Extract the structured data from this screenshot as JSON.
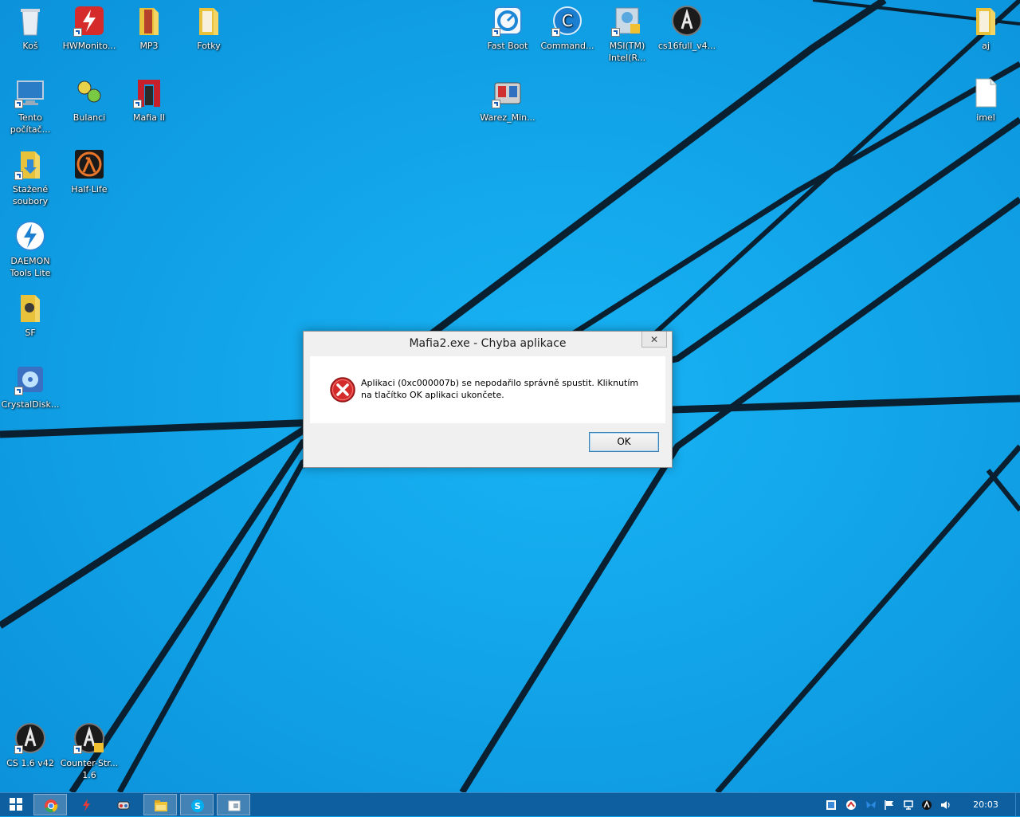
{
  "desktop": {
    "icons": [
      {
        "label": "Koš",
        "icon": "recycle-bin-icon"
      },
      {
        "label": "HWMonito...",
        "icon": "hwmonitor-icon"
      },
      {
        "label": "MP3",
        "icon": "folder-icon"
      },
      {
        "label": "Fotky",
        "icon": "folder-icon"
      },
      {
        "label": "Fast Boot",
        "icon": "fast-boot-icon"
      },
      {
        "label": "Command...",
        "icon": "command-center-icon"
      },
      {
        "label": "MSI(TM) Intel(R...",
        "icon": "msi-icon"
      },
      {
        "label": "cs16full_v4...",
        "icon": "counter-strike-icon"
      },
      {
        "label": "aj",
        "icon": "folder-icon"
      },
      {
        "label": "Tento počítač...",
        "icon": "computer-icon"
      },
      {
        "label": "Bulanci",
        "icon": "bulanci-icon"
      },
      {
        "label": "Mafia II",
        "icon": "mafia-icon"
      },
      {
        "label": "Warez_Min...",
        "icon": "warez-icon"
      },
      {
        "label": "imel",
        "icon": "file-icon"
      },
      {
        "label": "Stažené soubory",
        "icon": "downloads-folder-icon"
      },
      {
        "label": "Half-Life",
        "icon": "half-life-icon"
      },
      {
        "label": "DAEMON Tools Lite",
        "icon": "daemon-tools-icon"
      },
      {
        "label": "SF",
        "icon": "folder-icon"
      },
      {
        "label": "CrystalDisk...",
        "icon": "crystaldisk-icon"
      },
      {
        "label": "CS 1.6 v42",
        "icon": "counter-strike-icon"
      },
      {
        "label": "Counter-Str... 1.6",
        "icon": "counter-strike-icon"
      }
    ]
  },
  "dialog": {
    "title": "Mafia2.exe - Chyba aplikace",
    "close_glyph": "✕",
    "message": "Aplikaci (0xc000007b) se nepodařilo správně spustit. Kliknutím na tlačítko OK aplikaci ukončete.",
    "ok_label": "OK",
    "icon": "error-icon"
  },
  "taskbar": {
    "buttons": [
      "start-icon",
      "chrome-icon",
      "hwmonitor-icon",
      "game-icon",
      "file-explorer-icon",
      "skype-icon",
      "window-icon"
    ],
    "clock": "20:03"
  },
  "colors": {
    "wallpaper": "#0aa2ea",
    "taskbar": "#0d5fa0",
    "error": "#d42a2a"
  }
}
